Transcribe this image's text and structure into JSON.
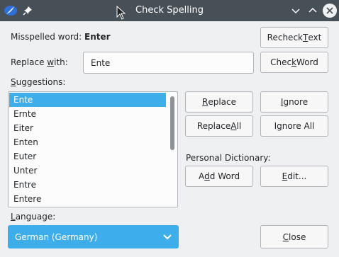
{
  "window": {
    "title": "Check Spelling"
  },
  "icons": {
    "app": "quill-pen-icon",
    "pin": "pin-icon",
    "minimize": "chevron-down-icon",
    "maximize": "chevron-up-icon",
    "close": "close-icon"
  },
  "misspelled": {
    "label": "Misspelled word:",
    "value": "Enter"
  },
  "replace": {
    "label_pre": "Replace ",
    "label_u": "w",
    "label_post": "ith:",
    "value": "Ente"
  },
  "suggestions": {
    "label_u": "S",
    "label_post": "uggestions:",
    "items": [
      "Ente",
      "Ernte",
      "Eiter",
      "Enten",
      "Euter",
      "Unter",
      "Entre",
      "Entere"
    ],
    "selected": "Ente"
  },
  "buttons": {
    "recheck": {
      "pre": "Recheck ",
      "u": "T",
      "post": "ext"
    },
    "check_word": {
      "pre": "Chec",
      "u": "k",
      "post": " Word"
    },
    "replace": {
      "pre": "",
      "u": "R",
      "post": "eplace"
    },
    "ignore": {
      "pre": "",
      "u": "I",
      "post": "gnore"
    },
    "replace_all": {
      "pre": "Replace ",
      "u": "A",
      "post": "ll"
    },
    "ignore_all": {
      "pre": "I",
      "u": "g",
      "post": "nore All"
    },
    "add_word": {
      "pre": "A",
      "u": "d",
      "post": "d Word"
    },
    "edit": {
      "pre": "",
      "u": "E",
      "post": "dit..."
    },
    "close": {
      "pre": "",
      "u": "C",
      "post": "lose"
    }
  },
  "personal_dictionary": {
    "label": "Personal Dictionary:"
  },
  "language": {
    "label_u": "L",
    "label_post": "anguage:",
    "selected": "German (Germany)"
  },
  "colors": {
    "titlebar": "#475057",
    "accent": "#3daee9",
    "window_bg": "#eff0f1"
  }
}
